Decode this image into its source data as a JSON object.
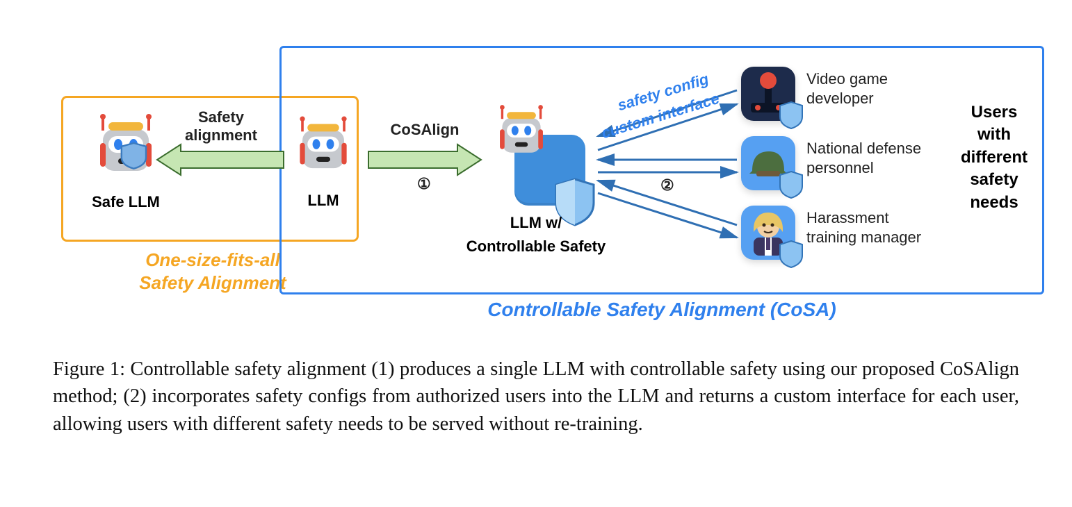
{
  "diagram": {
    "orange_box_label": "One-size-fits-all\nSafety Alignment",
    "blue_box_label": "Controllable Safety Alignment (CoSA)",
    "robots": {
      "safe_llm": "Safe LLM",
      "llm": "LLM",
      "llm_controllable_line1": "LLM w/",
      "llm_controllable_line2": "Controllable Safety"
    },
    "arrows": {
      "safety_alignment_line1": "Safety",
      "safety_alignment_line2": "alignment",
      "cosalign": "CoSAlign",
      "step1": "①",
      "step2": "②",
      "safety_config": "safety config",
      "custom_interface": "custom interface"
    },
    "users": {
      "heading_l1": "Users",
      "heading_l2": "with",
      "heading_l3": "different",
      "heading_l4": "safety",
      "heading_l5": "needs",
      "u1_l1": "Video game",
      "u1_l2": "developer",
      "u2_l1": "National defense",
      "u2_l2": "personnel",
      "u3_l1": "Harassment",
      "u3_l2": "training manager"
    },
    "icons": {
      "robot": "robot-icon",
      "shield": "shield-icon",
      "joystick": "joystick-icon",
      "helmet": "helmet-icon",
      "manager": "manager-icon"
    }
  },
  "caption": "Figure 1: Controllable safety alignment (1) produces a single LLM with controllable safety using our proposed CoSAlign method; (2) incorporates safety configs from authorized users into the LLM and returns a custom interface for each user, allowing users with different safety needs to be served without re-training."
}
